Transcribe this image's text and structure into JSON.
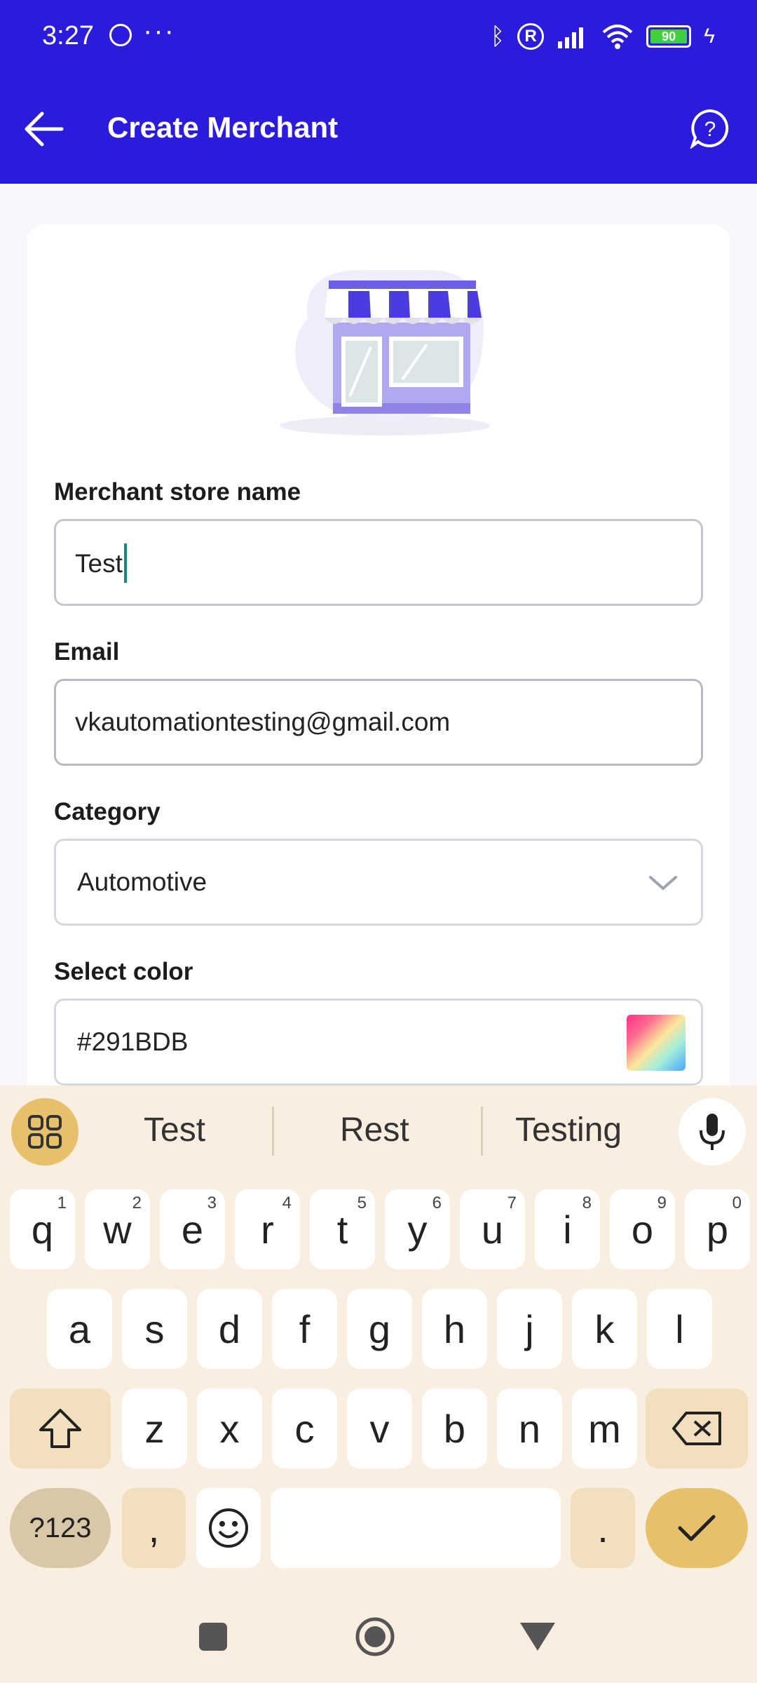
{
  "status_bar": {
    "time": "3:27",
    "dots": "···",
    "battery": "90"
  },
  "app_bar": {
    "title": "Create Merchant"
  },
  "form": {
    "store_name": {
      "label": "Merchant store name",
      "value": "Test"
    },
    "email": {
      "label": "Email",
      "value": "vkautomationtesting@gmail.com"
    },
    "category": {
      "label": "Category",
      "value": "Automotive"
    },
    "color": {
      "label": "Select color",
      "value": "#291BDB"
    }
  },
  "keyboard": {
    "suggestions": [
      "Test",
      "Rest",
      "Testing"
    ],
    "row1": [
      {
        "k": "q",
        "h": "1"
      },
      {
        "k": "w",
        "h": "2"
      },
      {
        "k": "e",
        "h": "3"
      },
      {
        "k": "r",
        "h": "4"
      },
      {
        "k": "t",
        "h": "5"
      },
      {
        "k": "y",
        "h": "6"
      },
      {
        "k": "u",
        "h": "7"
      },
      {
        "k": "i",
        "h": "8"
      },
      {
        "k": "o",
        "h": "9"
      },
      {
        "k": "p",
        "h": "0"
      }
    ],
    "row2": [
      "a",
      "s",
      "d",
      "f",
      "g",
      "h",
      "j",
      "k",
      "l"
    ],
    "row3": [
      "z",
      "x",
      "c",
      "v",
      "b",
      "n",
      "m"
    ],
    "symbols_label": "?123",
    "comma": ",",
    "period": "."
  },
  "colors": {
    "primary": "#2B1BDB",
    "keyboard_bg": "#F9EEDF",
    "accent": "#E6C06A",
    "caret": "#0E8A7A"
  }
}
